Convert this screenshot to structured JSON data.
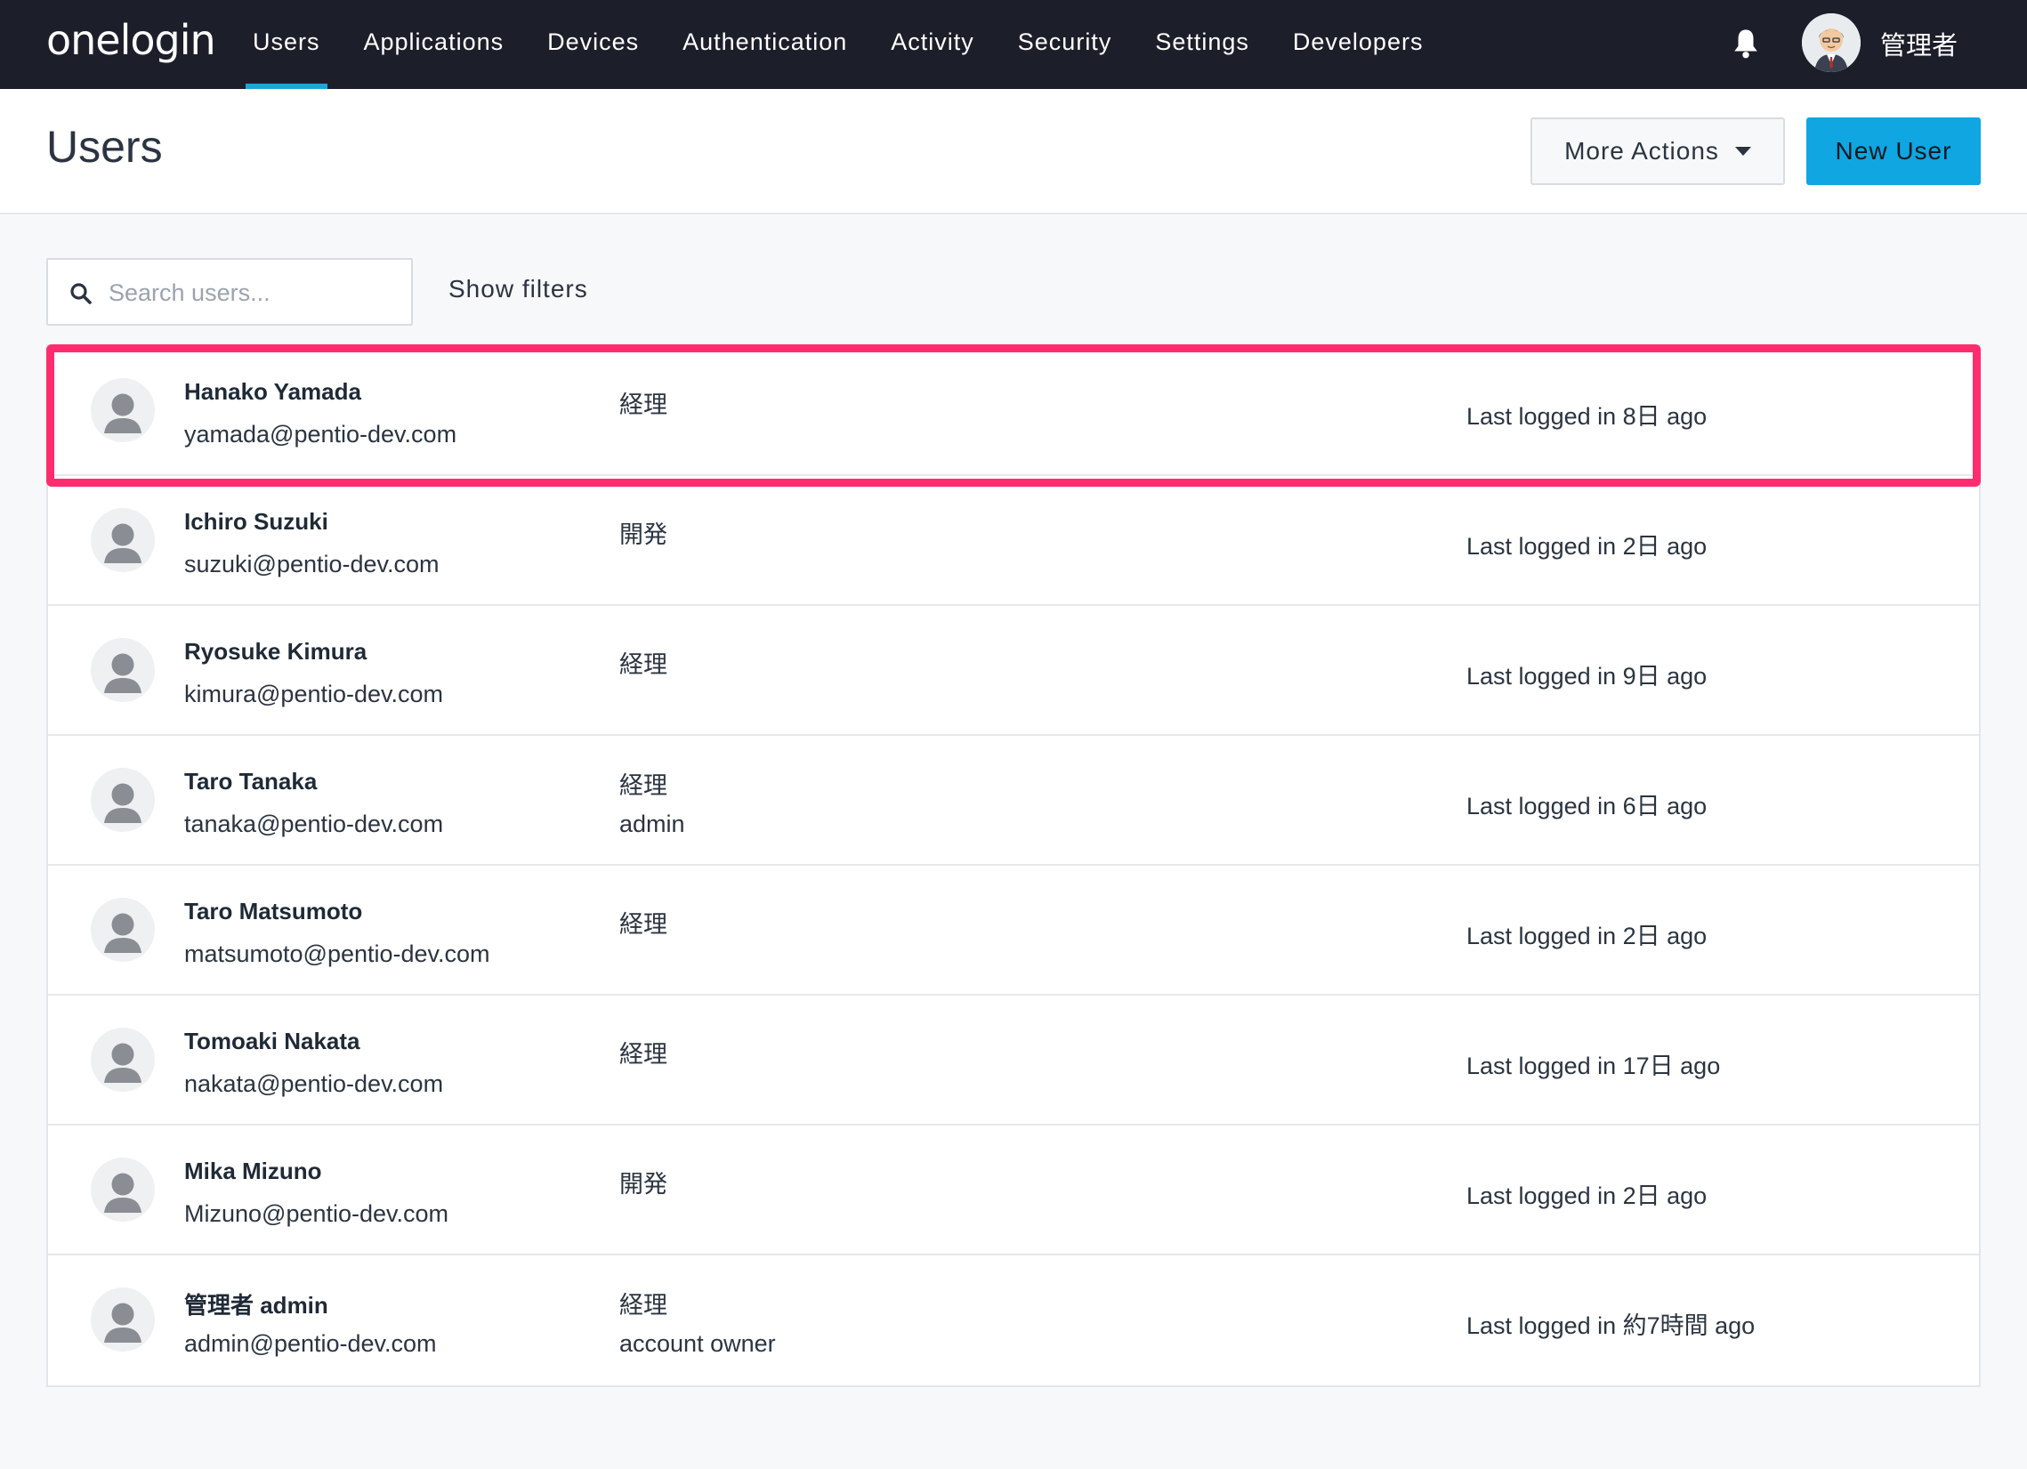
{
  "nav": {
    "logo": "onelogin",
    "items": [
      {
        "label": "Users",
        "active": true
      },
      {
        "label": "Applications",
        "active": false
      },
      {
        "label": "Devices",
        "active": false
      },
      {
        "label": "Authentication",
        "active": false
      },
      {
        "label": "Activity",
        "active": false
      },
      {
        "label": "Security",
        "active": false
      },
      {
        "label": "Settings",
        "active": false
      },
      {
        "label": "Developers",
        "active": false
      }
    ],
    "user_name": "管理者",
    "accent_color": "#1ca7d8"
  },
  "header": {
    "title": "Users",
    "more_actions_label": "More Actions",
    "new_user_label": "New User"
  },
  "search": {
    "placeholder": "Search users...",
    "value": ""
  },
  "filters": {
    "show_label": "Show filters"
  },
  "users": [
    {
      "name": "Hanako Yamada",
      "email": "yamada@pentio-dev.com",
      "roles": [
        "経理"
      ],
      "last_login": "Last logged in 8日 ago",
      "highlighted": true
    },
    {
      "name": "Ichiro Suzuki",
      "email": "suzuki@pentio-dev.com",
      "roles": [
        "開発"
      ],
      "last_login": "Last logged in 2日 ago"
    },
    {
      "name": "Ryosuke Kimura",
      "email": "kimura@pentio-dev.com",
      "roles": [
        "経理"
      ],
      "last_login": "Last logged in 9日 ago"
    },
    {
      "name": "Taro Tanaka",
      "email": "tanaka@pentio-dev.com",
      "roles": [
        "経理",
        "admin"
      ],
      "last_login": "Last logged in 6日 ago"
    },
    {
      "name": "Taro Matsumoto",
      "email": "matsumoto@pentio-dev.com",
      "roles": [
        "経理"
      ],
      "last_login": "Last logged in 2日 ago"
    },
    {
      "name": "Tomoaki Nakata",
      "email": "nakata@pentio-dev.com",
      "roles": [
        "経理"
      ],
      "last_login": "Last logged in 17日 ago"
    },
    {
      "name": "Mika Mizuno",
      "email": "Mizuno@pentio-dev.com",
      "roles": [
        "開発"
      ],
      "last_login": "Last logged in 2日 ago"
    },
    {
      "name": "管理者 admin",
      "email": "admin@pentio-dev.com",
      "roles": [
        "経理",
        "account owner"
      ],
      "last_login": "Last logged in 約7時間 ago"
    }
  ],
  "highlight_color": "#ff2d6f"
}
